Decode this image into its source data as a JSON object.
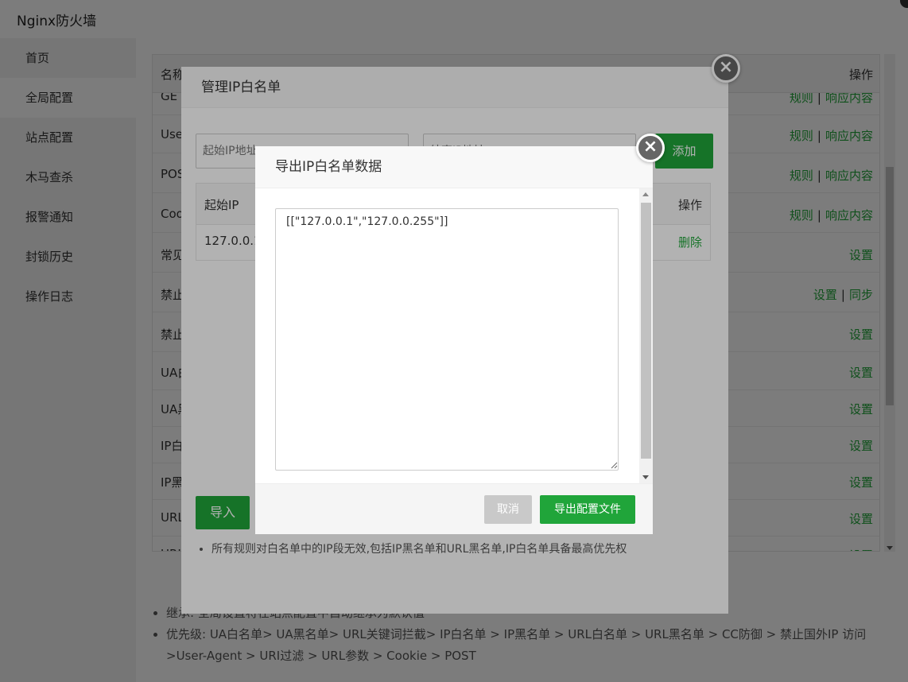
{
  "app": {
    "title": "Nginx防火墙"
  },
  "sidebar": {
    "items": [
      {
        "label": "首页"
      },
      {
        "label": "全局配置"
      },
      {
        "label": "站点配置"
      },
      {
        "label": "木马查杀"
      },
      {
        "label": "报警通知"
      },
      {
        "label": "封锁历史"
      },
      {
        "label": "操作日志"
      }
    ],
    "active_index": 1
  },
  "table": {
    "headers": {
      "name": "名称",
      "ops": "操作"
    },
    "rows": [
      {
        "name": "GE",
        "links": [
          "规则",
          "响应内容"
        ]
      },
      {
        "name": "Use",
        "links": [
          "规则",
          "响应内容"
        ]
      },
      {
        "name": "POS",
        "links": [
          "规则",
          "响应内容"
        ]
      },
      {
        "name": "Coo",
        "links": [
          "规则",
          "响应内容"
        ]
      },
      {
        "name": "常见",
        "links": [
          "设置"
        ]
      },
      {
        "name": "禁止",
        "links": [
          "设置",
          "同步"
        ]
      },
      {
        "name": "禁止",
        "links": [
          "设置"
        ]
      },
      {
        "name": "UA白",
        "links": [
          "设置"
        ]
      },
      {
        "name": "UA黑",
        "links": [
          "设置"
        ]
      },
      {
        "name": "IP白",
        "links": [
          "设置"
        ]
      },
      {
        "name": "IP黑",
        "links": [
          "设置"
        ]
      },
      {
        "name": "URL",
        "links": [
          "设置"
        ]
      },
      {
        "name": "URL",
        "links": [
          "设置"
        ]
      }
    ]
  },
  "notes": [
    "继承: 全局设置将在站点配置中自动继承为默认值",
    "优先级: UA白名单> UA黑名单> URL关键词拦截> IP白名单 > IP黑名单 > URL白名单 > URL黑名单 > CC防御 > 禁止国外IP 访问 >User-Agent > URI过滤 > URL参数 > Cookie > POST"
  ],
  "whitelist_dialog": {
    "title": "管理IP白名单",
    "start_placeholder": "起始IP地址",
    "end_placeholder": "结束IP地址",
    "add_label": "添加",
    "columns": {
      "start": "起始IP",
      "ops": "操作"
    },
    "rows": [
      {
        "start": "127.0.0.1",
        "action": "删除"
      }
    ],
    "import_label": "导入",
    "note": "所有规则对白名单中的IP段无效,包括IP黑名单和URL黑名单,IP白名单具备最高优先权"
  },
  "export_dialog": {
    "title": "导出IP白名单数据",
    "content": "[[\"127.0.0.1\",\"127.0.0.255\"]]",
    "cancel_label": "取消",
    "export_label": "导出配置文件"
  },
  "colors": {
    "accent": "#20a53a",
    "cancel": "#c9c9c9",
    "overlay": "rgba(0,0,0,0.3)"
  },
  "icons": {
    "close": "close-icon"
  }
}
